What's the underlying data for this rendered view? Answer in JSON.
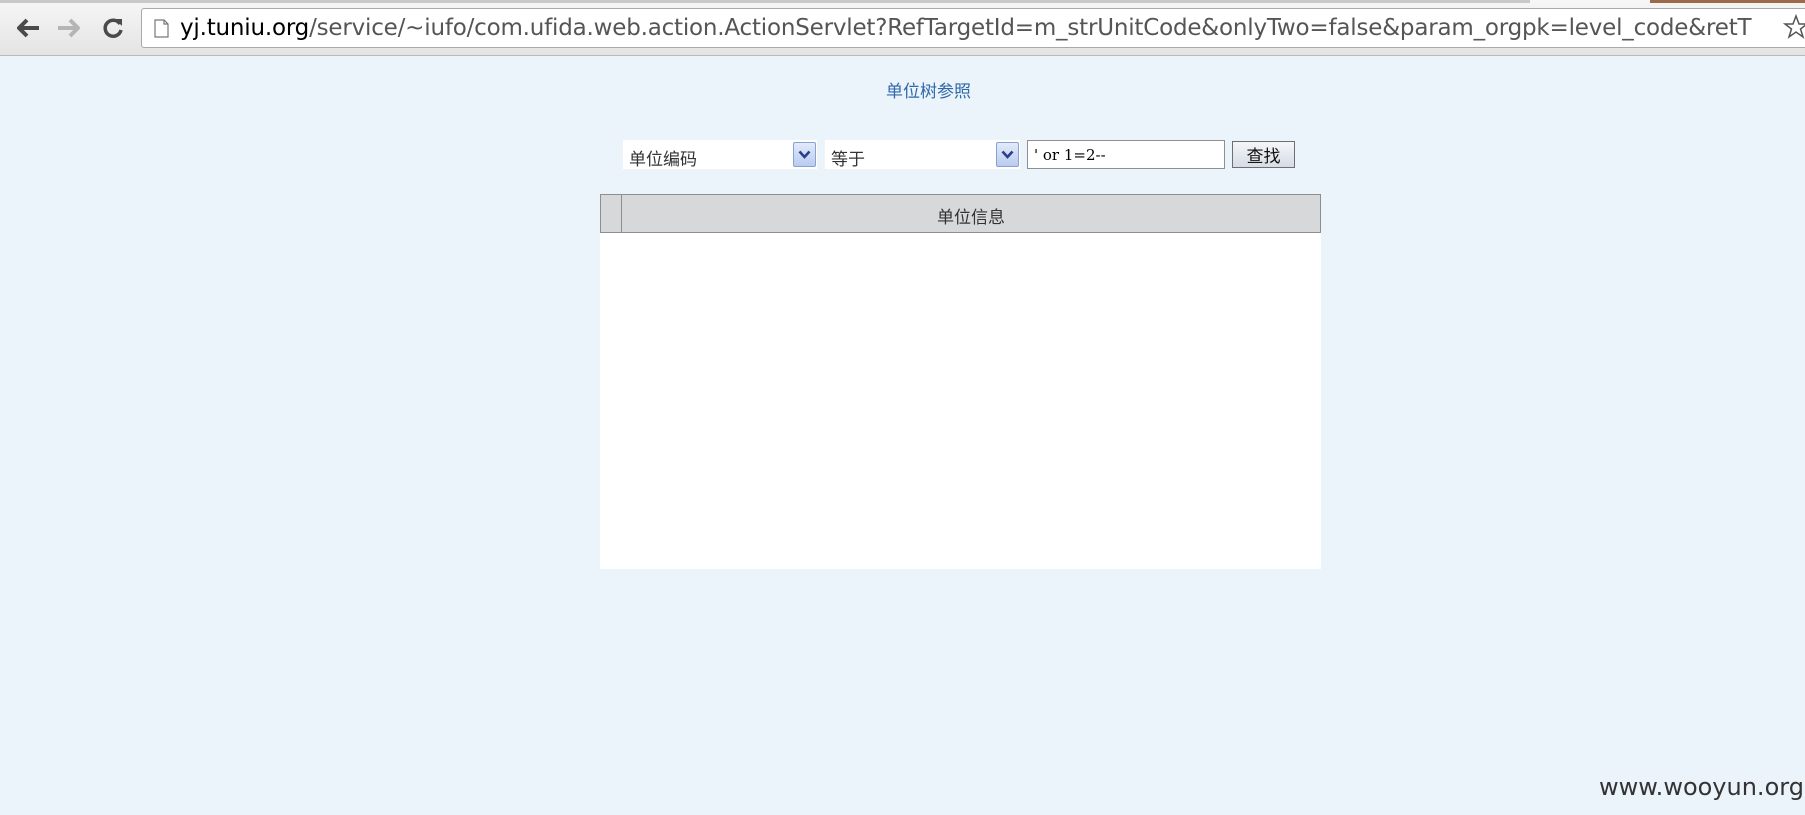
{
  "browser": {
    "url_host": "yj.tuniu.org",
    "url_path": "/service/~iufo/com.ufida.web.action.ActionServlet?RefTargetId=m_strUnitCode&onlyTwo=false&param_orgpk=level_code&retT"
  },
  "page": {
    "title": "单位树参照",
    "field_select": "单位编码",
    "operator_select": "等于",
    "search_value": "' or 1=2--",
    "find_label": "查找",
    "table_header": "单位信息"
  },
  "watermark": "www.wooyun.org",
  "colors": {
    "background": "#ebf3fb",
    "title_link": "#2f6aa9",
    "table_header_bg": "#d7d8d9"
  }
}
